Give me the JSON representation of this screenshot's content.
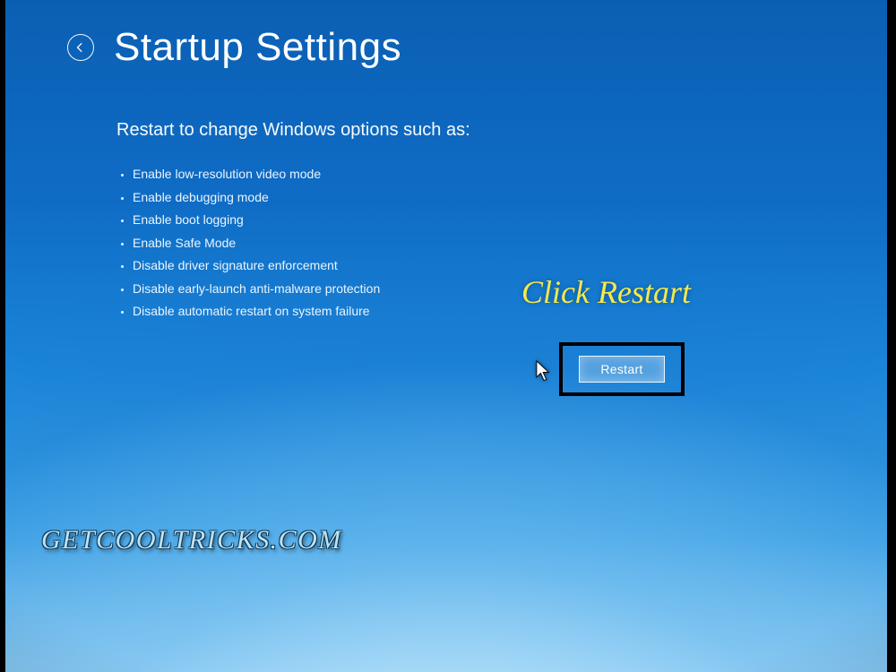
{
  "header": {
    "title": "Startup Settings",
    "back_icon": "back-arrow-icon"
  },
  "subheading": "Restart to change Windows options such as:",
  "options": [
    "Enable low-resolution video mode",
    "Enable debugging mode",
    "Enable boot logging",
    "Enable Safe Mode",
    "Disable driver signature enforcement",
    "Disable early-launch anti-malware protection",
    "Disable automatic restart on system failure"
  ],
  "annotation": "Click Restart",
  "restart_button": "Restart",
  "watermark": "GETCOOLTRICKS.COM",
  "colors": {
    "bg_top": "#0b5fb3",
    "bg_bottom": "#9bd6f4",
    "annotation": "#f5e84a",
    "highlight_border": "#000000",
    "text": "#ffffff"
  }
}
